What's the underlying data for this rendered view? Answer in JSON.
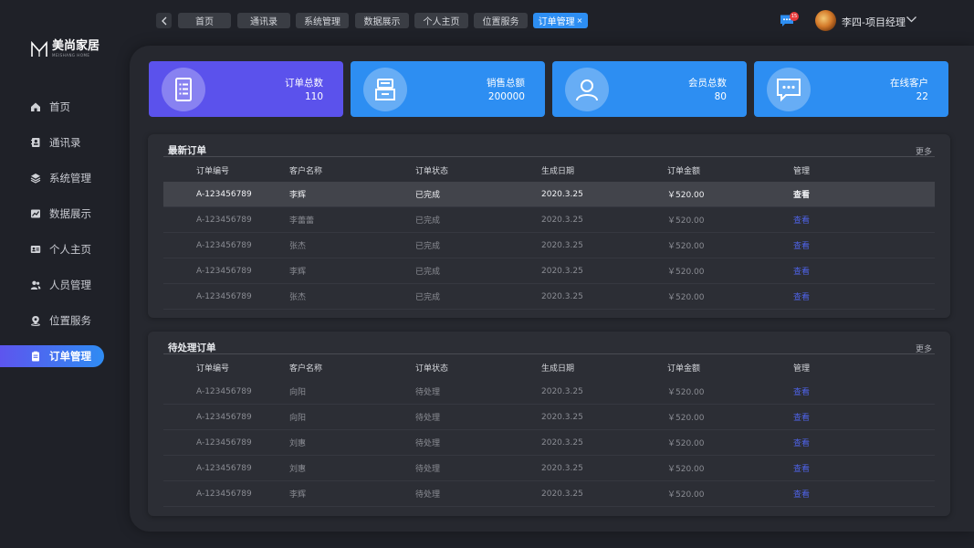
{
  "logo": {
    "name": "美尚家居",
    "sub": "MEISHANG HOME"
  },
  "sidebar": {
    "items": [
      {
        "label": "首页",
        "icon": "home-icon"
      },
      {
        "label": "通讯录",
        "icon": "contacts-icon"
      },
      {
        "label": "系统管理",
        "icon": "layers-icon"
      },
      {
        "label": "数据展示",
        "icon": "chart-icon"
      },
      {
        "label": "个人主页",
        "icon": "id-card-icon"
      },
      {
        "label": "人员管理",
        "icon": "users-icon"
      },
      {
        "label": "位置服务",
        "icon": "location-icon"
      },
      {
        "label": "订单管理",
        "icon": "clipboard-icon",
        "active": true
      }
    ]
  },
  "tabs": [
    "首页",
    "通讯录",
    "系统管理",
    "数据展示",
    "个人主页",
    "位置服务",
    "订单管理"
  ],
  "active_tab_close": "×",
  "header": {
    "badge_count": "15",
    "user_name": "李四-项目经理"
  },
  "stats": [
    {
      "label": "订单总数",
      "value": "110",
      "color": "#5b52ec"
    },
    {
      "label": "销售总额",
      "value": "200000",
      "color": "#2d8ef2"
    },
    {
      "label": "会员总数",
      "value": "80",
      "color": "#2d8ef2"
    },
    {
      "label": "在线客户",
      "value": "22",
      "color": "#2d8ef2"
    }
  ],
  "latest_orders": {
    "title": "最新订单",
    "more": "更多",
    "columns": [
      "订单编号",
      "客户名称",
      "订单状态",
      "生成日期",
      "订单金额",
      "管理"
    ],
    "rows": [
      [
        "A-123456789",
        "李辉",
        "已完成",
        "2020.3.25",
        "￥520.00",
        "查看"
      ],
      [
        "A-123456789",
        "李蕾蕾",
        "已完成",
        "2020.3.25",
        "￥520.00",
        "查看"
      ],
      [
        "A-123456789",
        "张杰",
        "已完成",
        "2020.3.25",
        "￥520.00",
        "查看"
      ],
      [
        "A-123456789",
        "李辉",
        "已完成",
        "2020.3.25",
        "￥520.00",
        "查看"
      ],
      [
        "A-123456789",
        "张杰",
        "已完成",
        "2020.3.25",
        "￥520.00",
        "查看"
      ]
    ]
  },
  "pending_orders": {
    "title": "待处理订单",
    "more": "更多",
    "columns": [
      "订单编号",
      "客户名称",
      "订单状态",
      "生成日期",
      "订单金额",
      "管理"
    ],
    "rows": [
      [
        "A-123456789",
        "向阳",
        "待处理",
        "2020.3.25",
        "￥520.00",
        "查看"
      ],
      [
        "A-123456789",
        "向阳",
        "待处理",
        "2020.3.25",
        "￥520.00",
        "查看"
      ],
      [
        "A-123456789",
        "刘惠",
        "待处理",
        "2020.3.25",
        "￥520.00",
        "查看"
      ],
      [
        "A-123456789",
        "刘惠",
        "待处理",
        "2020.3.25",
        "￥520.00",
        "查看"
      ],
      [
        "A-123456789",
        "李辉",
        "待处理",
        "2020.3.25",
        "￥520.00",
        "查看"
      ]
    ]
  }
}
